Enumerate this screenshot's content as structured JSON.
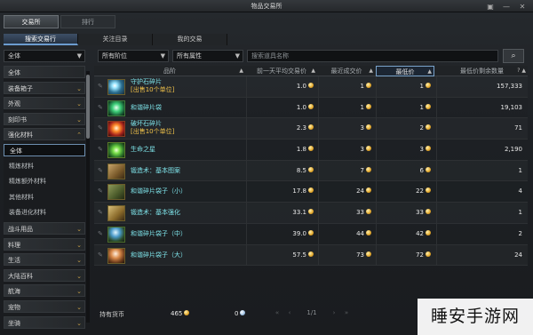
{
  "window": {
    "title": "物品交易所",
    "icons": [
      "window-icon",
      "minimize-icon",
      "close-icon"
    ]
  },
  "main_tabs": [
    {
      "label": "交易所",
      "active": true
    },
    {
      "label": "排行",
      "active": false
    }
  ],
  "sub_tabs": [
    {
      "label": "搜索交易行",
      "active": true
    },
    {
      "label": "关注目录",
      "active": false
    },
    {
      "label": "我的交易",
      "active": false
    }
  ],
  "filters": {
    "category": "全体",
    "grade": "所有阶位",
    "type": "所有属性",
    "search_placeholder": "搜索道具名称"
  },
  "sidebar": {
    "items": [
      {
        "label": "全体",
        "kind": "header",
        "chevron": ""
      },
      {
        "label": "装备箱子",
        "kind": "header",
        "chevron": "⌄"
      },
      {
        "label": "外观",
        "kind": "header",
        "chevron": "⌄"
      },
      {
        "label": "刻印书",
        "kind": "header",
        "chevron": "⌄"
      },
      {
        "label": "强化材料",
        "kind": "header",
        "chevron": "⌃"
      },
      {
        "label": "全体",
        "kind": "sub",
        "active": true
      },
      {
        "label": "精炼材料",
        "kind": "sub"
      },
      {
        "label": "精炼额外材料",
        "kind": "sub"
      },
      {
        "label": "其他材料",
        "kind": "sub"
      },
      {
        "label": "装备进化材料",
        "kind": "sub"
      },
      {
        "label": "战斗用品",
        "kind": "header",
        "chevron": "⌄"
      },
      {
        "label": "料理",
        "kind": "header",
        "chevron": "⌄"
      },
      {
        "label": "生活",
        "kind": "header",
        "chevron": "⌄"
      },
      {
        "label": "大陆百科",
        "kind": "header",
        "chevron": "⌄"
      },
      {
        "label": "航海",
        "kind": "header",
        "chevron": "⌄"
      },
      {
        "label": "宠物",
        "kind": "header",
        "chevron": "⌄"
      },
      {
        "label": "坐骑",
        "kind": "header",
        "chevron": "⌄"
      }
    ]
  },
  "table": {
    "headers": [
      "品阶",
      "前一天平均交易价",
      "最近成交价",
      "最低价",
      "最低价剩余数量"
    ],
    "rows": [
      {
        "name": "守护石碎片",
        "sub": "[出售10个单位]",
        "icon": "guardian-stone-shard-icon",
        "avg": "1.0",
        "recent": "1",
        "lowest": "1",
        "qty": "157,333"
      },
      {
        "name": "和谐碎片袋",
        "sub": "",
        "icon": "harmony-shard-pouch-icon",
        "avg": "1.0",
        "recent": "1",
        "lowest": "1",
        "qty": "19,103"
      },
      {
        "name": "破坏石碎片",
        "sub": "[出售10个单位]",
        "icon": "destruction-stone-shard-icon",
        "avg": "2.3",
        "recent": "3",
        "lowest": "2",
        "qty": "71"
      },
      {
        "name": "生命之星",
        "sub": "",
        "icon": "star-of-life-icon",
        "avg": "1.8",
        "recent": "3",
        "lowest": "3",
        "qty": "2,190"
      },
      {
        "name": "锻造术：基本图案",
        "sub": "",
        "icon": "forging-scroll-icon",
        "avg": "8.5",
        "recent": "7",
        "lowest": "6",
        "qty": "1"
      },
      {
        "name": "和谐碎片袋子（小）",
        "sub": "",
        "icon": "harmony-pouch-small-icon",
        "avg": "17.8",
        "recent": "24",
        "lowest": "22",
        "qty": "4"
      },
      {
        "name": "锻造术：基本强化",
        "sub": "",
        "icon": "forging-enhance-scroll-icon",
        "avg": "33.1",
        "recent": "33",
        "lowest": "33",
        "qty": "1"
      },
      {
        "name": "和谐碎片袋子（中）",
        "sub": "",
        "icon": "harmony-pouch-medium-icon",
        "avg": "39.0",
        "recent": "44",
        "lowest": "42",
        "qty": "2"
      },
      {
        "name": "和谐碎片袋子（大）",
        "sub": "",
        "icon": "harmony-pouch-large-icon",
        "avg": "57.5",
        "recent": "73",
        "lowest": "72",
        "qty": "24"
      }
    ]
  },
  "bottom": {
    "currency_label": "持有货币",
    "gold": "465",
    "silver": "0",
    "page": "1/1"
  },
  "watermark": "睡安手游网",
  "colors": {
    "accent": "#6c9ccf",
    "name": "#7ee3e9",
    "gold": "#f0c24a"
  }
}
